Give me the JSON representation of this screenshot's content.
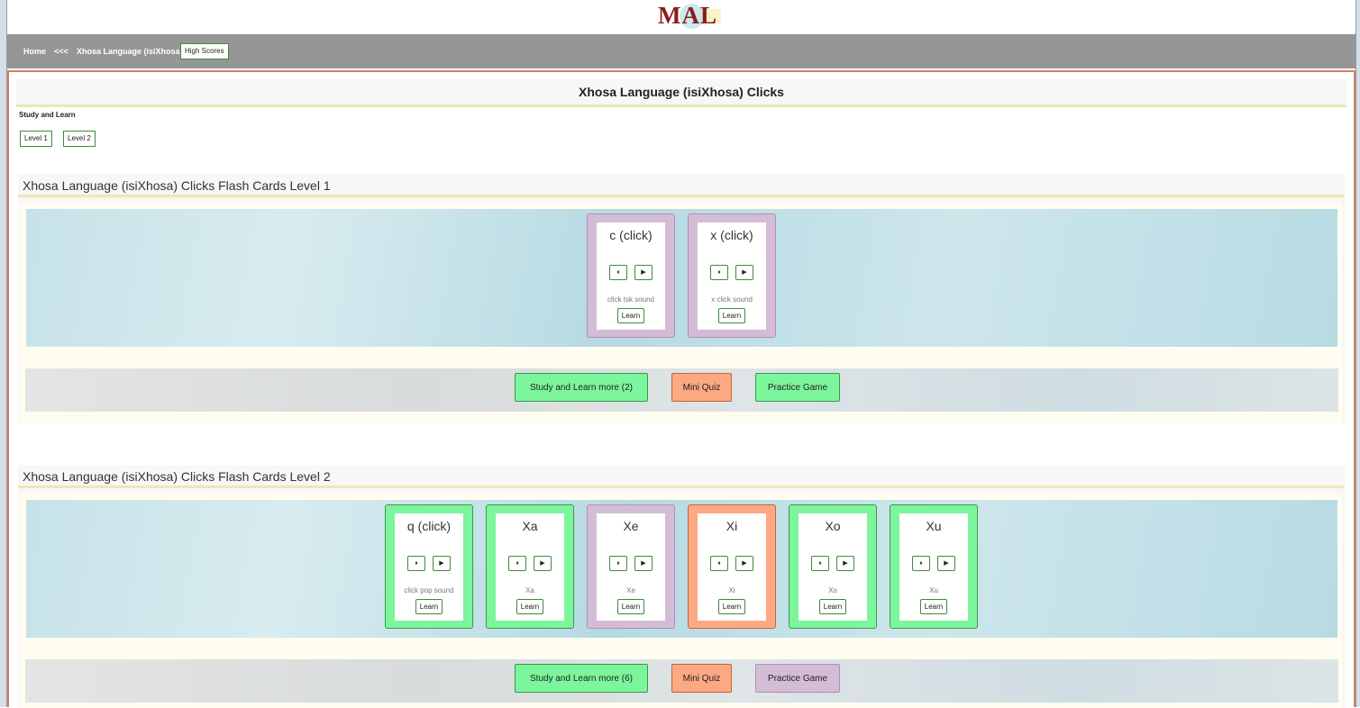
{
  "logo": "MAL",
  "nav": {
    "home": "Home",
    "back": "<<<",
    "current": "Xhosa Language (isiXhosa)",
    "high_scores": "High Scores"
  },
  "page": {
    "title": "Xhosa Language (isiXhosa) Clicks",
    "study_label": "Study and Learn",
    "levels": [
      "Level 1",
      "Level 2"
    ]
  },
  "sections": [
    {
      "title": "Xhosa Language (isiXhosa) Clicks Flash Cards Level 1",
      "cards": [
        {
          "word": "c (click)",
          "desc": "click tsk sound",
          "color": "purple"
        },
        {
          "word": "x (click)",
          "desc": "x click sound",
          "color": "purple"
        }
      ],
      "actions": [
        {
          "label": "Study and Learn more (2)",
          "color": "green"
        },
        {
          "label": "Mini Quiz",
          "color": "orange"
        },
        {
          "label": "Practice Game",
          "color": "green"
        }
      ]
    },
    {
      "title": "Xhosa Language (isiXhosa) Clicks Flash Cards Level 2",
      "cards": [
        {
          "word": "q (click)",
          "desc": "click pop sound",
          "color": "green"
        },
        {
          "word": "Xa",
          "desc": "Xa",
          "color": "green"
        },
        {
          "word": "Xe",
          "desc": "Xe",
          "color": "purple"
        },
        {
          "word": "Xi",
          "desc": "Xi",
          "color": "orange"
        },
        {
          "word": "Xo",
          "desc": "Xo",
          "color": "green"
        },
        {
          "word": "Xu",
          "desc": "Xu",
          "color": "green"
        }
      ],
      "actions": [
        {
          "label": "Study and Learn more (6)",
          "color": "green"
        },
        {
          "label": "Mini Quiz",
          "color": "orange"
        },
        {
          "label": "Practice Game",
          "color": "purple"
        }
      ]
    }
  ],
  "card_controls": {
    "pause": "⏸",
    "play": "▶",
    "learn": "Learn"
  },
  "colors": {
    "green": "#7cf59c",
    "purple": "#d4bcd6",
    "orange": "#fca983"
  }
}
